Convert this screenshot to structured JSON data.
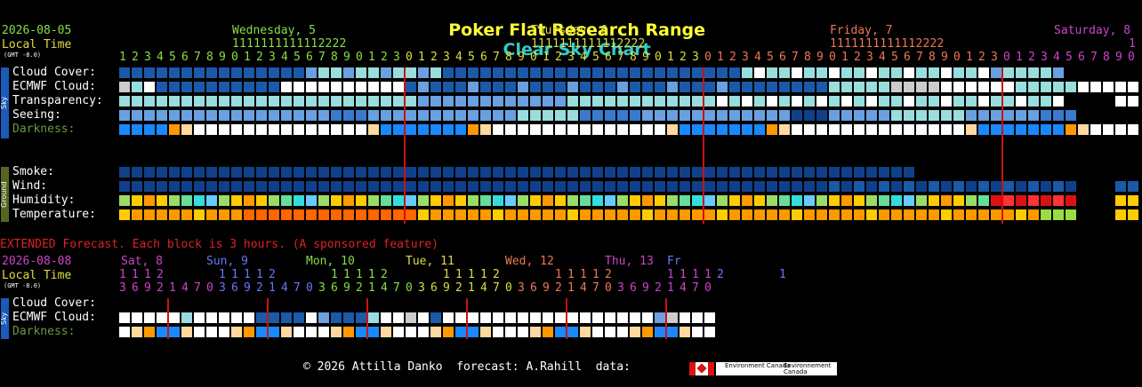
{
  "title": {
    "location": "Poker Flat Research Range",
    "suffix": "Clear Sky Chart"
  },
  "header": {
    "date": "2026-08-05",
    "local_time": "Local Time",
    "gmt": "(GMT -8.0)",
    "days": [
      {
        "label": "Wednesday, 5",
        "color": "#88dd44"
      },
      {
        "label": "Thursday, 6",
        "color": "#dddd44"
      },
      {
        "label": "Friday, 7",
        "color": "#ee7755"
      },
      {
        "label": "Saturday, 8",
        "color": "#cc44cc"
      }
    ],
    "tens": [
      "1111111111112222",
      "1111111111112222",
      "1111111111112222",
      "1"
    ],
    "ones_row": "1234567890123456789012301234567890123456789012301234567890123456789012301234567890"
  },
  "rows_sky": [
    {
      "label": "Cloud Cover:"
    },
    {
      "label": "ECMWF Cloud:"
    },
    {
      "label": "Transparency:"
    },
    {
      "label": "Seeing:"
    },
    {
      "label": "Darkness:",
      "color": "#669944"
    }
  ],
  "rows_ground": [
    {
      "label": "Smoke:"
    },
    {
      "label": "Wind:"
    },
    {
      "label": "Humidity:"
    },
    {
      "label": "Temperature:"
    }
  ],
  "side_labels": {
    "sky": "Sky",
    "ground": "Ground"
  },
  "extended": {
    "notice": "EXTENDED Forecast. Each block is 3 hours. (A sponsored feature)",
    "date": "2026-08-08",
    "local_time": "Local Time",
    "gmt": "(GMT -8.0)",
    "days": [
      {
        "label": "Sat, 8",
        "color": "#cc44cc"
      },
      {
        "label": "Sun, 9",
        "color": "#6677ff"
      },
      {
        "label": "Mon, 10",
        "color": "#88dd44"
      },
      {
        "label": "Tue, 11",
        "color": "#dddd44"
      },
      {
        "label": "Wed, 12",
        "color": "#ee7755"
      },
      {
        "label": "Thu, 13",
        "color": "#cc44cc"
      },
      {
        "label": "Fr",
        "color": "#6677ff"
      }
    ],
    "tens_row": "1112    11112    11112    11112    11112    11112    1",
    "ones_row": "369214703692147036921470369214703692147036921470",
    "rows": [
      {
        "label": "Cloud Cover:"
      },
      {
        "label": "ECMWF Cloud:"
      },
      {
        "label": "Darkness:",
        "color": "#669944"
      }
    ]
  },
  "footer": {
    "text": "© 2026 Attilla Danko  forecast: A.Rahill  data:",
    "logo1": "Environment Canada",
    "logo2": "Environnement Canada"
  },
  "palette": {
    "deep": "#0a3a8a",
    "dblue": "#1a5aa8",
    "blue": "#3a7acc",
    "lblue": "#6aa0e0",
    "cyan": "#99dddd",
    "lgrey": "#cccccc",
    "white": "#ffffff",
    "navy": "#10408a",
    "dark_blue": "#0066cc",
    "bright_blue": "#1a88ff",
    "orange": "#ff9900",
    "peach": "#ffd9a0",
    "yellow": "#ffcc00",
    "red": "#dd1111",
    "green": "#99dd66",
    "midnight": "#cc1111"
  }
}
